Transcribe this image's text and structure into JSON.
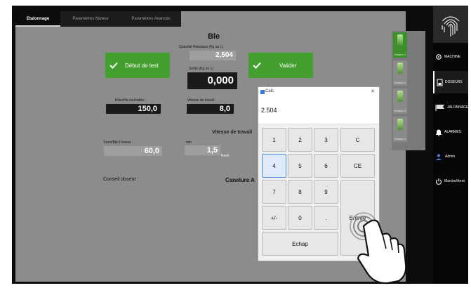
{
  "tabs": [
    {
      "label": "Etalonnage"
    },
    {
      "label": "Paramètres Moteur"
    },
    {
      "label": "Paramètres Avancés"
    }
  ],
  "product": "Ble",
  "theo": {
    "label": "Quantité théorique (Kg ou L)",
    "value": "2,504"
  },
  "sortie": {
    "label": "Sortie (Kg ou L)",
    "value": "0,000"
  },
  "start_button": "Début de test",
  "validate_button": "Valider",
  "kilos": {
    "label": "Kilos/Ha souhaités :",
    "value": "150,0"
  },
  "vitesse": {
    "label": "Vitesse de travail :",
    "value": "8,0"
  },
  "vitesse_travail_label": "Vitesse de travail",
  "tours": {
    "label": "Tours/Min Doseur :",
    "value": "60,0"
  },
  "min": {
    "label": "min",
    "value": "1,5",
    "unit": "Km/h"
  },
  "conseil_label": "Conseil doseur :",
  "canelure_text": "Canelure A",
  "doseurs": [
    {
      "label": "Doseur 1"
    },
    {
      "label": "Doseur 2"
    },
    {
      "label": "Doseur 3"
    },
    {
      "label": "Doseur 4"
    }
  ],
  "sidebar": [
    {
      "label": "MACHINE",
      "icon": "gear-icon"
    },
    {
      "label": "DOSEURS",
      "icon": "doser-icon"
    },
    {
      "label": "JALONNAGE",
      "icon": "flag-icon"
    },
    {
      "label": "ALARMES",
      "icon": "bell-icon"
    },
    {
      "label": "Admin",
      "icon": "admin-icon"
    },
    {
      "label": "Marche/Arret",
      "icon": "power-icon"
    }
  ],
  "calc": {
    "title": "Calc",
    "display": "2.504",
    "keys": {
      "k1": "1",
      "k2": "2",
      "k3": "3",
      "kc": "C",
      "k4": "4",
      "k5": "5",
      "k6": "6",
      "kce": "CE",
      "k7": "7",
      "k8": "8",
      "k9": "9",
      "kpm": "+/-",
      "k0": "0",
      "kdot": ".",
      "kenter": "Entrée",
      "kesc": "Echap"
    }
  },
  "colors": {
    "accent_green": "#43a02e",
    "background": "#8c8c8c",
    "sidebar": "#060606"
  }
}
